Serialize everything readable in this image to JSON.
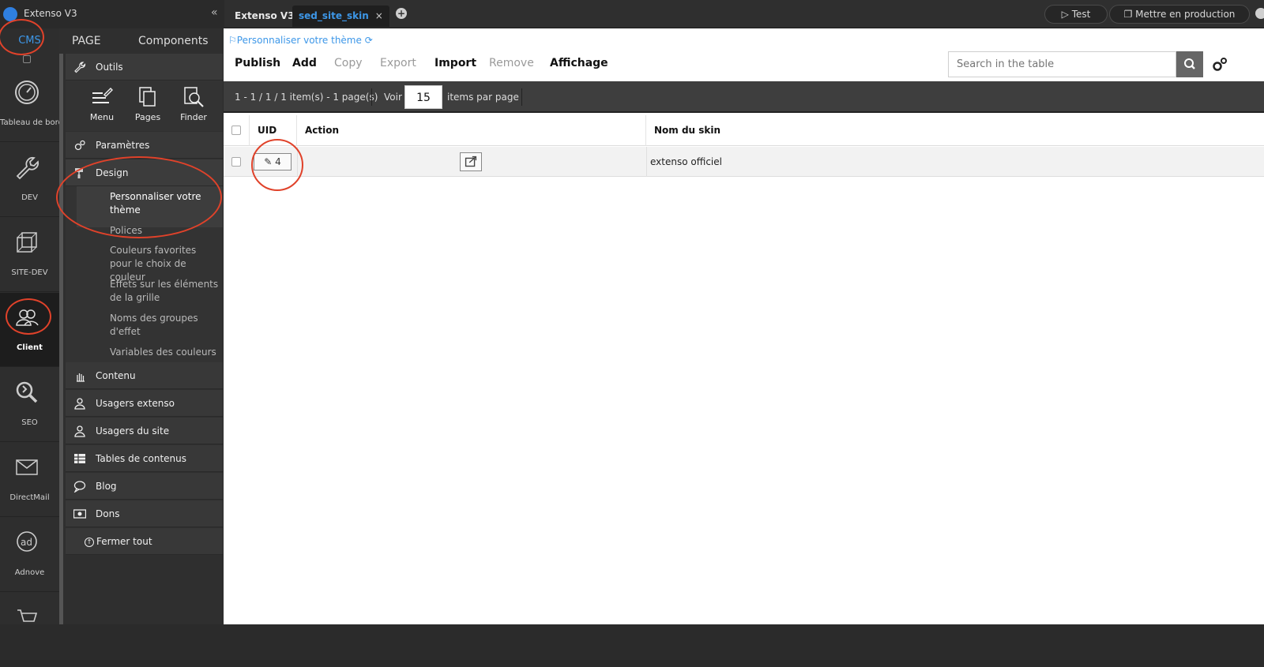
{
  "app": {
    "title": "Extenso V3",
    "collapse_symbol": "«"
  },
  "tabs": [
    {
      "label": "Extenso V3"
    },
    {
      "label": "sed_site_skin",
      "close": "×"
    }
  ],
  "top_actions": {
    "test": "▷ Test",
    "production": "❐ Mettre en production"
  },
  "rail": {
    "tab": "CMS",
    "items": [
      {
        "label": "Tableau de bord",
        "icon": "gauge-icon"
      },
      {
        "label": "DEV",
        "icon": "wrench-icon"
      },
      {
        "label": "SITE-DEV",
        "icon": "cube-icon"
      },
      {
        "label": "Client",
        "icon": "users-icon"
      },
      {
        "label": "SEO",
        "icon": "seo-icon"
      },
      {
        "label": "DirectMail",
        "icon": "mail-icon"
      },
      {
        "label": "Adnove",
        "icon": "ad-icon"
      }
    ]
  },
  "sidebar": {
    "tabs": {
      "page": "PAGE",
      "components": "Components"
    },
    "outils": "Outils",
    "tools": [
      {
        "label": "Menu"
      },
      {
        "label": "Pages"
      },
      {
        "label": "Finder"
      }
    ],
    "parametres": "Paramètres",
    "design": "Design",
    "design_links": [
      "Personnaliser votre thème",
      "Polices",
      "Couleurs favorites pour le choix de couleur",
      "Effets sur les éléments de la grille",
      "Noms des groupes d'effet",
      "Variables des couleurs"
    ],
    "items": [
      "Contenu",
      "Usagers extenso",
      "Usagers du site",
      "Tables de contenus",
      "Blog",
      "Dons"
    ],
    "close_all": "Fermer tout"
  },
  "main": {
    "breadcrumb": "Personnaliser votre thème",
    "toolbar": {
      "publish": "Publish",
      "add": "Add",
      "copy": "Copy",
      "export": "Export",
      "import": "Import",
      "remove": "Remove",
      "affichage": "Affichage"
    },
    "search_placeholder": "Search in the table",
    "pager": {
      "summary": "1 - 1 / 1 / 1 item(s) - 1 page(s)",
      "voir": "Voir",
      "per_page": "15",
      "items_par_page": "items par page"
    },
    "columns": {
      "uid": "UID",
      "action": "Action",
      "nom": "Nom du skin"
    },
    "rows": [
      {
        "uid": "4",
        "nom": "extenso officiel"
      }
    ]
  },
  "colors": {
    "accent": "#3d97e8",
    "annotation": "#e0422a"
  }
}
